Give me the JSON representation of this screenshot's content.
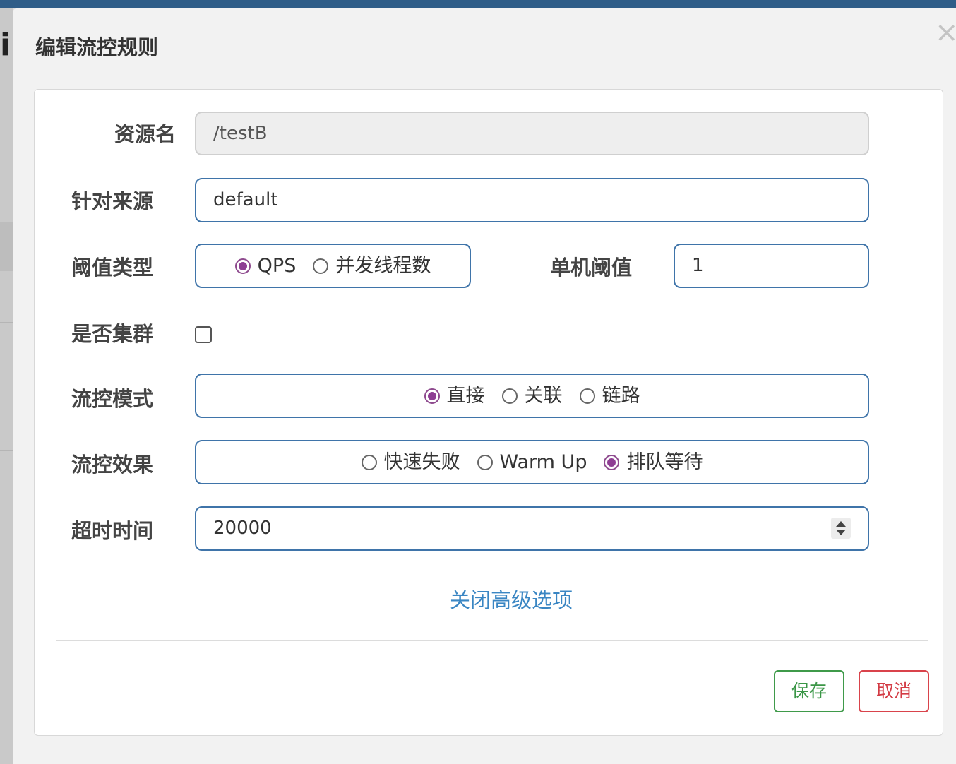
{
  "background": {
    "glyph": "i"
  },
  "dialog": {
    "title": "编辑流控规则",
    "close_symbol": "×"
  },
  "form": {
    "resource": {
      "label": "资源名",
      "value": "/testB"
    },
    "limit_app": {
      "label": "针对来源",
      "value": "default"
    },
    "threshold_type": {
      "label": "阈值类型",
      "options": [
        {
          "label": "QPS",
          "checked": true
        },
        {
          "label": "并发线程数",
          "checked": false
        }
      ]
    },
    "single_threshold": {
      "label": "单机阈值",
      "value": "1"
    },
    "cluster": {
      "label": "是否集群",
      "checked": false
    },
    "control_mode": {
      "label": "流控模式",
      "options": [
        {
          "label": "直接",
          "checked": true
        },
        {
          "label": "关联",
          "checked": false
        },
        {
          "label": "链路",
          "checked": false
        }
      ]
    },
    "control_effect": {
      "label": "流控效果",
      "options": [
        {
          "label": "快速失败",
          "checked": false
        },
        {
          "label": "Warm Up",
          "checked": false
        },
        {
          "label": "排队等待",
          "checked": true
        }
      ]
    },
    "timeout": {
      "label": "超时时间",
      "value": "20000"
    },
    "advanced_link": "关闭高级选项"
  },
  "footer": {
    "save_label": "保存",
    "cancel_label": "取消"
  },
  "colors": {
    "primary_border": "#3f74a9",
    "radio_checked": "#8e3d93",
    "link": "#3a86c3",
    "save": "#3a9646",
    "cancel": "#d33b44"
  }
}
